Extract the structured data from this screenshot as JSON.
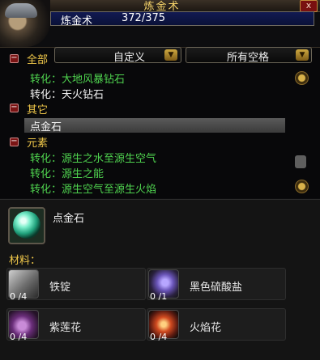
{
  "window": {
    "title": "炼金术",
    "close_label": "x"
  },
  "skill": {
    "name": "炼金术",
    "value": "372/375",
    "bar_fill_fraction": 0.992
  },
  "filters": {
    "all_label": "全部",
    "subclass_dropdown": "自定义",
    "slot_dropdown": "所有空格"
  },
  "recipe_list": [
    {
      "type": "category",
      "label": "全部",
      "collapse_symbol": "−"
    },
    {
      "type": "recipe",
      "label": "转化：大地风暴钻石",
      "color": "#4fd34f"
    },
    {
      "type": "recipe",
      "label": "转化：天火钻石",
      "color": "#f2f2f2"
    },
    {
      "type": "category",
      "label": "其它",
      "collapse_symbol": "−"
    },
    {
      "type": "recipe",
      "label": "点金石",
      "color": "#f2f2f2",
      "selected": true
    },
    {
      "type": "category",
      "label": "元素",
      "collapse_symbol": "−"
    },
    {
      "type": "recipe",
      "label": "转化：源生之水至源生空气",
      "color": "#4fd34f"
    },
    {
      "type": "recipe",
      "label": "转化：源生之能",
      "color": "#4fd34f"
    },
    {
      "type": "recipe",
      "label": "转化：源生空气至源生火焰",
      "color": "#4fd34f"
    }
  ],
  "detail": {
    "item_name": "点金石",
    "materials_label": "材料："
  },
  "reagents": [
    {
      "name": "铁锭",
      "count": "0 /4",
      "icon": "iron-ingot-icon"
    },
    {
      "name": "黑色硫酸盐",
      "count": "0 /1",
      "icon": "black-vitriol-icon"
    },
    {
      "name": "紫莲花",
      "count": "0 /4",
      "icon": "purple-lotus-icon"
    },
    {
      "name": "火焰花",
      "count": "0 /4",
      "icon": "firebloom-icon"
    }
  ],
  "colors": {
    "category_gold": "#f0c84a",
    "green_recipe": "#4fd34f",
    "skillbar_blue": "#121a52"
  }
}
